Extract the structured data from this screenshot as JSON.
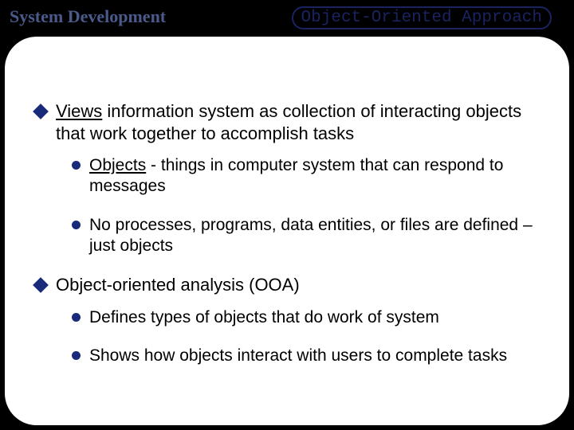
{
  "header": {
    "left": "System Development",
    "right": "Object-Oriented Approach"
  },
  "bullets": {
    "b1_lead": "Views",
    "b1_rest": " information system as collection of interacting objects that work together to accomplish tasks",
    "b1_sub1_lead": "Objects",
    "b1_sub1_rest": " - things in computer system that can respond to messages",
    "b1_sub2": "No processes, programs, data entities, or files are defined – just objects",
    "b2": "Object-oriented analysis (OOA)",
    "b2_sub1": "Defines types of objects that do work of system",
    "b2_sub2": "Shows how objects interact with users to complete tasks"
  }
}
